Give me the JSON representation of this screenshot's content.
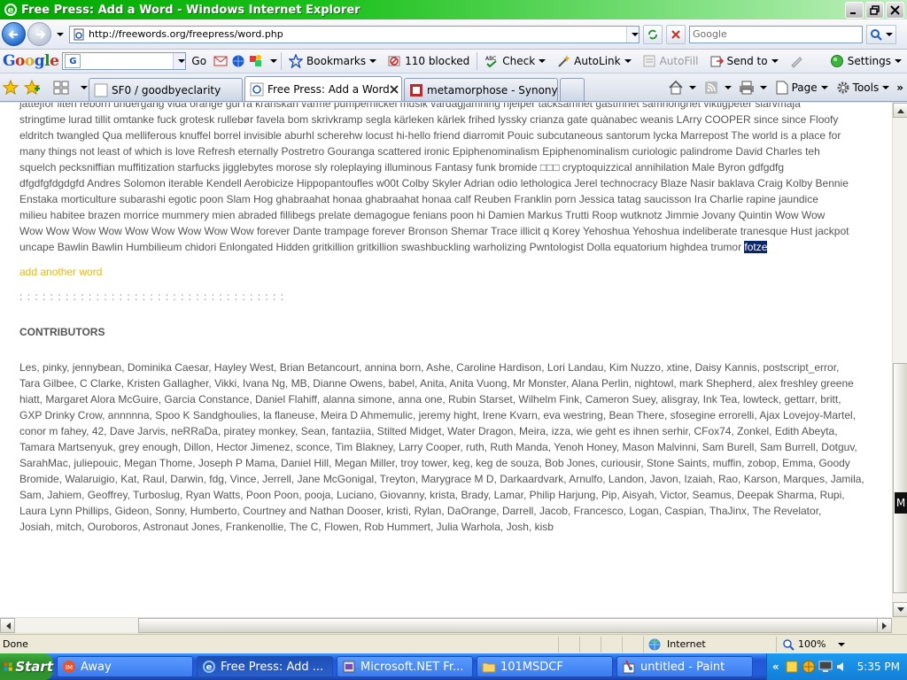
{
  "window": {
    "title": "Free Press: Add a Word - Windows Internet Explorer"
  },
  "address": {
    "url": "http://freewords.org/freepress/word.php",
    "search_placeholder": "Google"
  },
  "google_toolbar": {
    "logo": [
      "G",
      "o",
      "o",
      "g",
      "l",
      "e"
    ],
    "go_label": "Go",
    "bookmarks_label": "Bookmarks",
    "blocked_label": "110 blocked",
    "check_label": "Check",
    "autolink_label": "AutoLink",
    "autofill_label": "AutoFill",
    "sendto_label": "Send to",
    "settings_label": "Settings"
  },
  "tabs": [
    {
      "label": "SF0 / goodbyeclarity",
      "active": false
    },
    {
      "label": "Free Press: Add a Word",
      "active": true
    },
    {
      "label": "metamorphose - Synonyms f...",
      "active": false
    }
  ],
  "commands": {
    "page_label": "Page",
    "tools_label": "Tools"
  },
  "content": {
    "words_lines": [
      "jättejför liten reborn undergang vida orange gul ra kranskarl varme pumpernickel musik vardagjämning hjelper tacksamhet gastfrihet samhörighet viktigpeter siarvmaja",
      "stringtime lurad tillit omtanke fuck grotesk rullebør favela bom skrivkramp segla kärleken kärlek frihed lyssky crianza gate quànabec weanis LArry COOPER since since Floofy",
      "eldritch twangled Qua melliferous knuffel borrel invisible aburhl scherehw locust hi-hello friend diarromit Pouic subcutaneous santorum lycka Marrepost The world is a place for",
      "many things not least of which is love Refresh eternally Postretro Gouranga scattered ironic Epiphenominalism Epiphenominalism curiologic palindrome David Charles teh",
      "squelch pecksniffian muffitization starfucks jigglebytes morose sly roleplaying illuminous Fantasy funk bromide □□□ cryptoquizzical annihilation Male Byron gdfgdfg",
      "dfgdfgfdgdgfd Andres Solomon iterable Kendell Aerobicize Hippopantoufles w00t Colby Skyler Adrian odio lethologica Jerel technocracy Blaze Nasir baklava Craig Kolby Bennie",
      "Enstaka morticulture subarashi egotic poon Slam Hog ghabraahat honaa ghabraahat honaa calf Reuben Franklin porn Jessica tatag saucisson Ira Charlie rapine jaundice",
      "milieu habitee brazen morrice mummery mien abraded fillibegs prelate demagogue fenians poon hi Damien Markus Trutti Roop wutknotz Jimmie Jovany Quintin Wow Wow",
      "Wow Wow Wow Wow Wow Wow Wow Wow Wow forever Dante trampage forever Bronson Shemar Trace illicit q Korey Yehoshua Yehoshua indeliberate tranesque Hust jackpot",
      "uncape Bawlin Bawlin Humbilieum chidori Enlongated Hidden gritkillion gritkillion swashbuckling warholizing Pwntologist Dolla equatorium highdea trumor "
    ],
    "highlighted_word": "fotze",
    "add_link": "add another word",
    "dots": ": : : : : : : : : : : : : : : : : : : : : : : : : : : : : : : : : : :",
    "contributors_title": "CONTRIBUTORS",
    "contributors_lines": [
      "Les, pinky, jennybean, Dominika Caesar, Hayley West, Brian Betancourt, annina born, Ashe, Caroline Hardison, Lori Landau, Kim Nuzzo, xtine, Daisy Kannis, postscript_error,",
      "Tara Gilbee, C Clarke, Kristen Gallagher, Vikki, Ivana Ng, MB, Dianne Owens, babel, Anita, Anita Vuong, Mr Monster, Alana Perlin, nightowl, mark Shepherd, alex freshley greene",
      "hiatt, Margaret Alora McGuire, Garcia Constance, Daniel Flahiff, alanna simone, anna one, Rubin Starset, Wilhelm Fink, Cameron Suey, alisgray, Ink Tea, lowteck, gettarr, britt,",
      "GXP Drinky Crow, annnnna, Spoo K Sandghoulies, la flaneuse, Meira D Ahmemulic, jeremy hight, Irene Kvarn, eva westring, Bean There, sfosegine errorelli, Ajax Lovejoy-Martel,",
      "conor m fahey, 42, Dave Jarvis, neRRaDa, piratey monkey, Sean, fantaziia, Stilted Midget, Water Dragon, Meira, izza, wie geht es ihnen serhir, CFox74, Zonkel, Edith Abeyta,",
      "Tamara Martsenyuk, grey enough, Dillon, Hector Jimenez, sconce, Tim Blakney, Larry Cooper, ruth, Ruth Manda, Yenoh Honey, Mason Malvinni, Sam Burell, Sam Burrell, Dotguv,",
      "SarahMac, juliepouic, Megan Thome, Joseph P Mama, Daniel Hill, Megan Miller, troy tower, keg, keg de souza, Bob Jones, curiousir, Stone Saints, muffin, zobop, Emma, Goody",
      "Bromide, Walaruigio, Kat, Raul, Darwin, fdg, Vince, Jerrell, Jane McGonigal, Treyton, Marygrace M D, Darkaardvark, Arnulfo, Landon, Javon, Izaiah, Rao, Karson, Marques, Jamila,",
      "Sam, Jahiem, Geoffrey, Turboslug, Ryan Watts, Poon Poon, pooja, Luciano, Giovanny, krista, Brady, Lamar, Philip Harjung, Pip, Aisyah, Victor, Seamus, Deepak Sharma, Rupi,",
      "Laura Lynn Phillips, Gideon, Sonny, Humberto, Courtney and Nathan Dooser, kristi, Rylan, DaOrange, Darrell, Jacob, Francesco, Logan, Caspian, ThaJinx, The Revelator,",
      "Josiah, mitch, Ouroboros, Astronaut Jones, Frankenollie, The C, Flowen, Rob Hummert, Julia Warhola, Josh, kisb"
    ]
  },
  "side_tab": "M",
  "status": {
    "text": "Done",
    "zone": "Internet",
    "zoom": "100%"
  },
  "taskbar": {
    "start_label": "Start",
    "buttons": [
      {
        "label": "Away",
        "active": false
      },
      {
        "label": "Free Press: Add ...",
        "active": true
      },
      {
        "label": "Microsoft.NET Fr...",
        "active": false
      },
      {
        "label": "101MSDCF",
        "active": false
      },
      {
        "label": "untitled - Paint",
        "active": false
      }
    ],
    "clock": "5:35 PM"
  },
  "colors": {
    "title_bar": "#00a800",
    "add_link": "#f0b800",
    "highlight_bg": "#0a246a",
    "taskbar": "#245edb",
    "start": "#2f952f"
  }
}
